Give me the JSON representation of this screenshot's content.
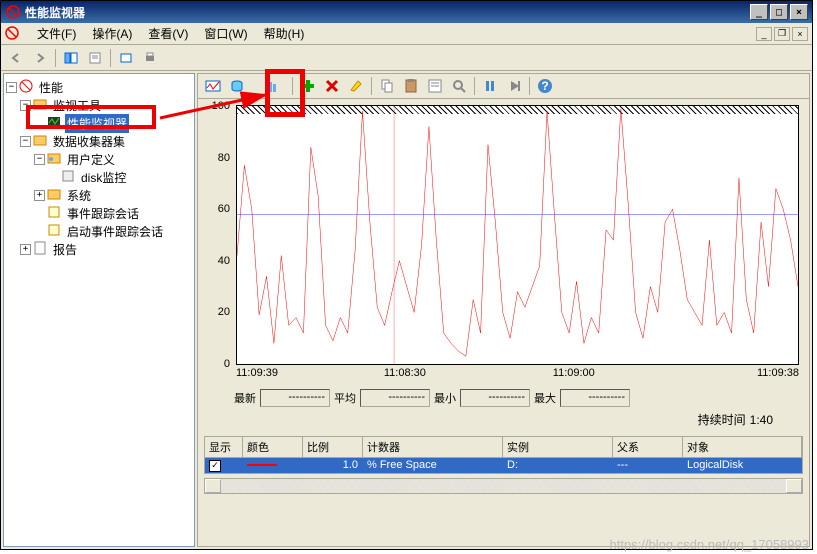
{
  "window": {
    "title": "性能监视器"
  },
  "menu": {
    "file": "文件(F)",
    "action": "操作(A)",
    "view": "查看(V)",
    "window": "窗口(W)",
    "help": "帮助(H)"
  },
  "tree": {
    "root": "性能",
    "n1": "监视工具",
    "n1a": "性能监视器",
    "n2": "数据收集器集",
    "n2a": "用户定义",
    "n2a1": "disk监控",
    "n2b": "系统",
    "n2c": "事件跟踪会话",
    "n2d": "启动事件跟踪会话",
    "n3": "报告"
  },
  "chart_data": {
    "type": "line",
    "title": "",
    "xlabel": "",
    "ylabel": "",
    "ylim": [
      0,
      100
    ],
    "yticks": [
      0,
      20,
      40,
      60,
      80,
      100
    ],
    "xticks": [
      "11:09:39",
      "11:08:30",
      "11:09:00",
      "11:09:38"
    ],
    "average_line": 58,
    "series": [
      {
        "name": "% Free Space",
        "color": "#ff0000",
        "values": [
          42,
          77,
          60,
          19,
          34,
          8,
          42,
          15,
          18,
          12,
          84,
          65,
          15,
          9,
          18,
          12,
          44,
          98,
          55,
          22,
          15,
          28,
          40,
          30,
          20,
          46,
          92,
          48,
          12,
          8,
          5,
          3,
          25,
          12,
          85,
          55,
          20,
          10,
          28,
          22,
          30,
          38,
          98,
          58,
          20,
          12,
          32,
          8,
          18,
          12,
          52,
          48,
          99,
          62,
          20,
          10,
          30,
          20,
          55,
          60,
          44,
          25,
          20,
          15,
          48,
          15,
          20,
          12,
          72,
          25,
          12,
          55,
          30,
          68,
          60,
          48,
          30
        ]
      }
    ]
  },
  "stats": {
    "latest_label": "最新",
    "latest_val": "----------",
    "avg_label": "平均",
    "avg_val": "----------",
    "min_label": "最小",
    "min_val": "----------",
    "max_label": "最大",
    "max_val": "----------",
    "duration_label": "持续时间",
    "duration_val": "1:40"
  },
  "grid": {
    "headers": {
      "show": "显示",
      "color": "颜色",
      "scale": "比例",
      "counter": "计数器",
      "instance": "实例",
      "parent": "父系",
      "object": "对象"
    },
    "row": {
      "scale": "1.0",
      "counter": "% Free Space",
      "instance": "D:",
      "parent": "---",
      "object": "LogicalDisk"
    }
  },
  "watermark": "https://blog.csdn.net/qq_17058993"
}
